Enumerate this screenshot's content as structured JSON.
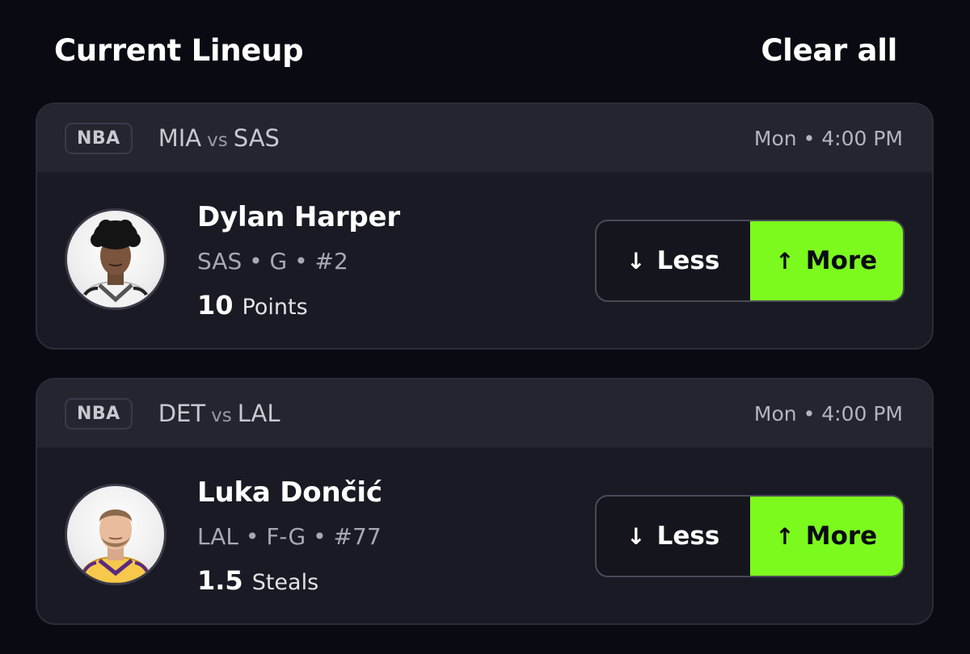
{
  "header": {
    "title": "Current Lineup",
    "clear_label": "Clear all"
  },
  "picks": [
    {
      "league": "NBA",
      "home": "MIA",
      "vs": "vs",
      "away": "SAS",
      "time": "Mon • 4:00 PM",
      "player_name": "Dylan Harper",
      "meta": "SAS • G • #2",
      "stat_value": "10",
      "stat_type": "Points",
      "less_label": "Less",
      "more_label": "More"
    },
    {
      "league": "NBA",
      "home": "DET",
      "vs": "vs",
      "away": "LAL",
      "time": "Mon • 4:00 PM",
      "player_name": "Luka Dončić",
      "meta": "LAL • F-G • #77",
      "stat_value": "1.5",
      "stat_type": "Steals",
      "less_label": "Less",
      "more_label": "More"
    }
  ],
  "icons": {
    "less_arrow": "arrow-down-icon",
    "more_arrow": "arrow-up-icon"
  },
  "colors": {
    "background": "#0a0a12",
    "card": "#1a1a24",
    "accent_more": "#7cfa1e"
  },
  "selected": {
    "pick_0": "More",
    "pick_1": "More"
  }
}
